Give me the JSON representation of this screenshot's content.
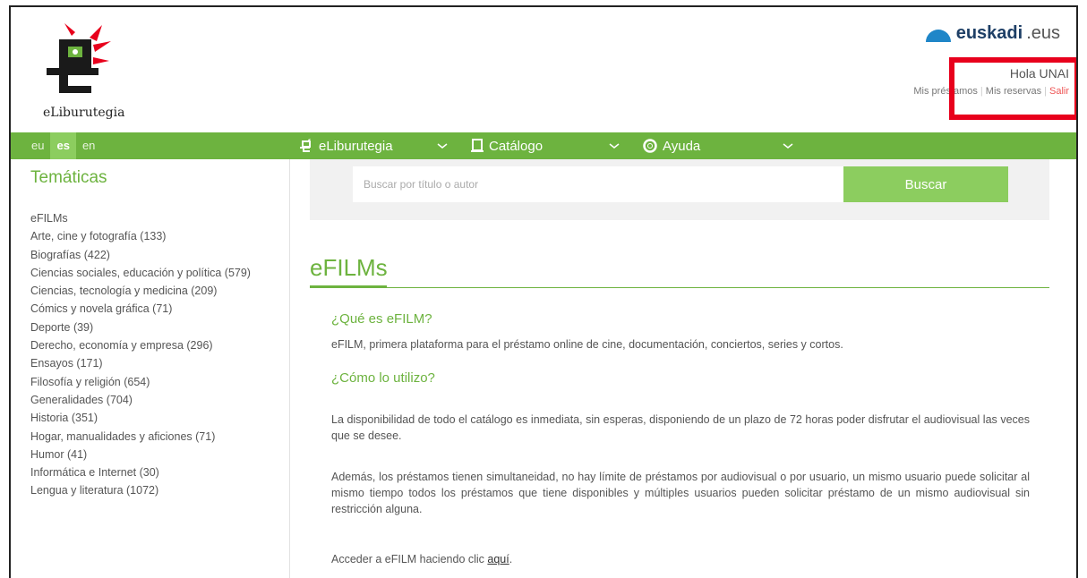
{
  "header": {
    "logo_text": "eLiburutegia",
    "euskadi_brand": "euskadi",
    "euskadi_tld": ".eus",
    "greeting": "Hola UNAI",
    "links": [
      "Mis préstamos",
      "Mis reservas",
      "Salir"
    ]
  },
  "nav": {
    "langs": [
      "eu",
      "es",
      "en"
    ],
    "active_lang": "es",
    "items": [
      "eLiburutegia",
      "Catálogo",
      "Ayuda"
    ]
  },
  "sidebar": {
    "title": "Temáticas",
    "items": [
      "eFILMs",
      "Arte, cine y fotografía (133)",
      "Biografías (422)",
      "Ciencias sociales, educación y política (579)",
      "Ciencias, tecnología y medicina (209)",
      "Cómics y novela gráfica (71)",
      "Deporte (39)",
      "Derecho, economía y empresa (296)",
      "Ensayos (171)",
      "Filosofía y religión (654)",
      "Generalidades (704)",
      "Historia (351)",
      "Hogar, manualidades y aficiones (71)",
      "Humor (41)",
      "Informática e Internet (30)",
      "Lengua y literatura (1072)"
    ]
  },
  "search": {
    "placeholder": "Buscar por título o autor",
    "button": "Buscar"
  },
  "main": {
    "title": "eFILMs",
    "q1": "¿Qué es eFILM?",
    "p1": "eFILM, primera plataforma para el préstamo online de cine, documentación, conciertos, series y cortos.",
    "q2": "¿Cómo lo utilizo?",
    "p2": "La disponibilidad de todo el catálogo es inmediata, sin esperas, disponiendo de un plazo de 72 horas poder disfrutar el audiovisual las veces que se desee.",
    "p3": "Además, los préstamos tienen simultaneidad, no hay límite de préstamos por audiovisual o por usuario, un mismo usuario puede solicitar al mismo tiempo todos los préstamos que tiene disponibles y múltiples usuarios pueden solicitar préstamo de un mismo audiovisual sin restricción alguna.",
    "p4_prefix": "Acceder a eFILM haciendo clic ",
    "p4_link": "aquí",
    "p4_suffix": "."
  },
  "colors": {
    "accent": "#6db33f",
    "highlight": "#e8001c"
  }
}
